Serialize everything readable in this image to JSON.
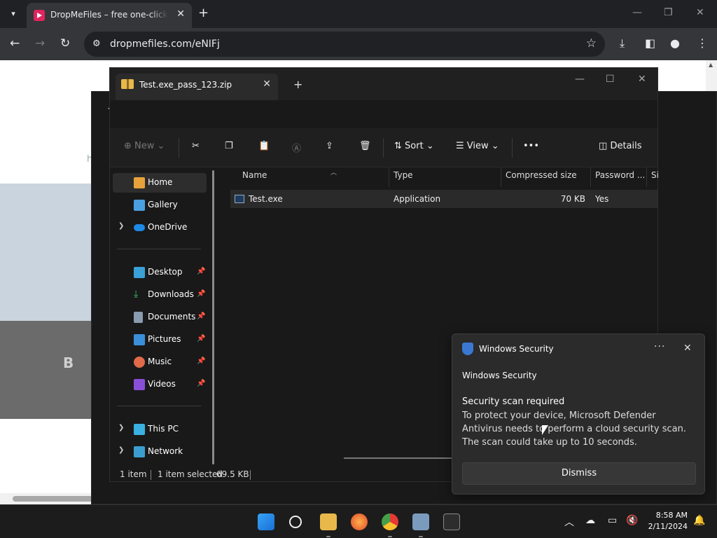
{
  "browser": {
    "tab_title": "DropMeFiles – free one-click file sharing",
    "url": "dropmefiles.com/eNIFj"
  },
  "webpage": {
    "http_fragment": "http",
    "letter_b": "B"
  },
  "explorer": {
    "tab_title": "Test.exe_pass_123.zip",
    "toolbar": {
      "new_label": "New",
      "sort_label": "Sort",
      "view_label": "View",
      "details_label": "Details"
    },
    "sidebar": {
      "home": "Home",
      "gallery": "Gallery",
      "onedrive": "OneDrive",
      "desktop": "Desktop",
      "downloads": "Downloads",
      "documents": "Documents",
      "pictures": "Pictures",
      "music": "Music",
      "videos": "Videos",
      "thispc": "This PC",
      "network": "Network"
    },
    "columns": {
      "name": "Name",
      "type": "Type",
      "compressed_size": "Compressed size",
      "password": "Password ...",
      "size": "Si"
    },
    "file": {
      "name": "Test.exe",
      "type": "Application",
      "compressed_size": "70 KB",
      "password": "Yes"
    },
    "status": {
      "count": "1 item",
      "selected": "1 item selected",
      "size": "69.5 KB"
    }
  },
  "toast": {
    "app_name": "Windows Security",
    "heading": "Windows Security",
    "title": "Security scan required",
    "body": "To protect your device, Microsoft Defender Antivirus needs to perform a cloud security scan. The scan could take up to 10 seconds.",
    "dismiss_label": "Dismiss",
    "more_label": "···",
    "close_label": "✕"
  },
  "taskbar": {
    "time": "8:58 AM",
    "date": "2/11/2024"
  },
  "colors": {
    "accent": "#3b78d4",
    "favicon": "#e0245e",
    "folder": "#e8b94a"
  }
}
